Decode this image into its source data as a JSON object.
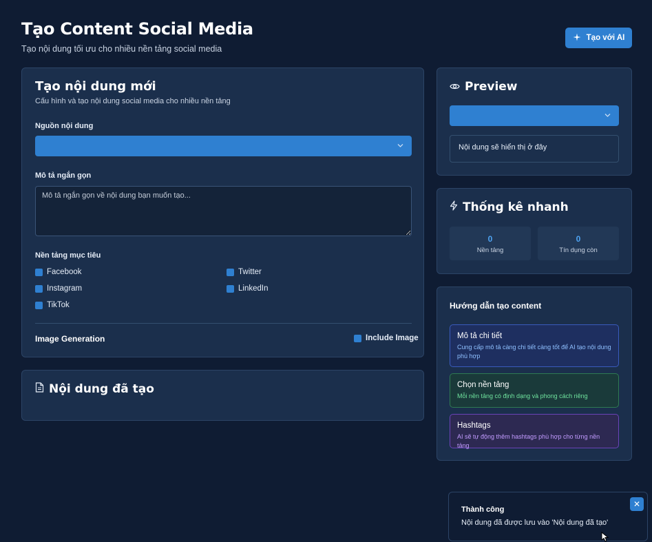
{
  "header": {
    "title": "Tạo Content Social Media",
    "subtitle": "Tạo nội dung tối ưu cho nhiều nền tảng social media",
    "ai_button_label": "Tạo với AI"
  },
  "form": {
    "title": "Tạo nội dung mới",
    "description": "Cấu hình và tạo nội dung social media cho nhiều nền tảng",
    "source_label": "Nguồn nội dung",
    "source_value": "",
    "short_desc_label": "Mô tả ngắn gọn",
    "short_desc_placeholder": "Mô tả ngắn gọn về nội dung bạn muốn tạo...",
    "platforms_label": "Nền tảng mục tiêu",
    "platforms": [
      "Facebook",
      "Twitter",
      "Instagram",
      "LinkedIn",
      "TikTok"
    ],
    "image_generation_label": "Image Generation",
    "include_image_label": "Include Image"
  },
  "generated": {
    "title": "Nội dung đã tạo"
  },
  "preview": {
    "title": "Preview",
    "select_value": "",
    "placeholder": "Nội dung sẽ hiển thị ở đây"
  },
  "stats": {
    "title": "Thống kê nhanh",
    "platforms_count": "0",
    "platforms_label": "Nền tảng",
    "credits_count": "0",
    "credits_label": "Tín dụng còn"
  },
  "guide": {
    "title": "Hướng dẫn tạo content",
    "tips": [
      {
        "title": "Mô tả chi tiết",
        "desc": "Cung cấp mô tả càng chi tiết càng tốt để AI tạo nội dung phù hợp"
      },
      {
        "title": "Chọn nền tảng",
        "desc": "Mỗi nền tảng có định dạng và phong cách riêng"
      },
      {
        "title": "Hashtags",
        "desc": "AI sẽ tự động thêm hashtags phù hợp cho từng nền tảng"
      }
    ]
  },
  "toast": {
    "title": "Thành công",
    "message": "Nội dung đã được lưu vào 'Nội dung đã tạo'"
  },
  "icons": {
    "sparkles": "sparkles-icon",
    "eye": "eye-icon",
    "lightning": "lightning-icon",
    "document": "document-icon",
    "chevron": "chevron-down-icon",
    "close": "close-icon"
  }
}
